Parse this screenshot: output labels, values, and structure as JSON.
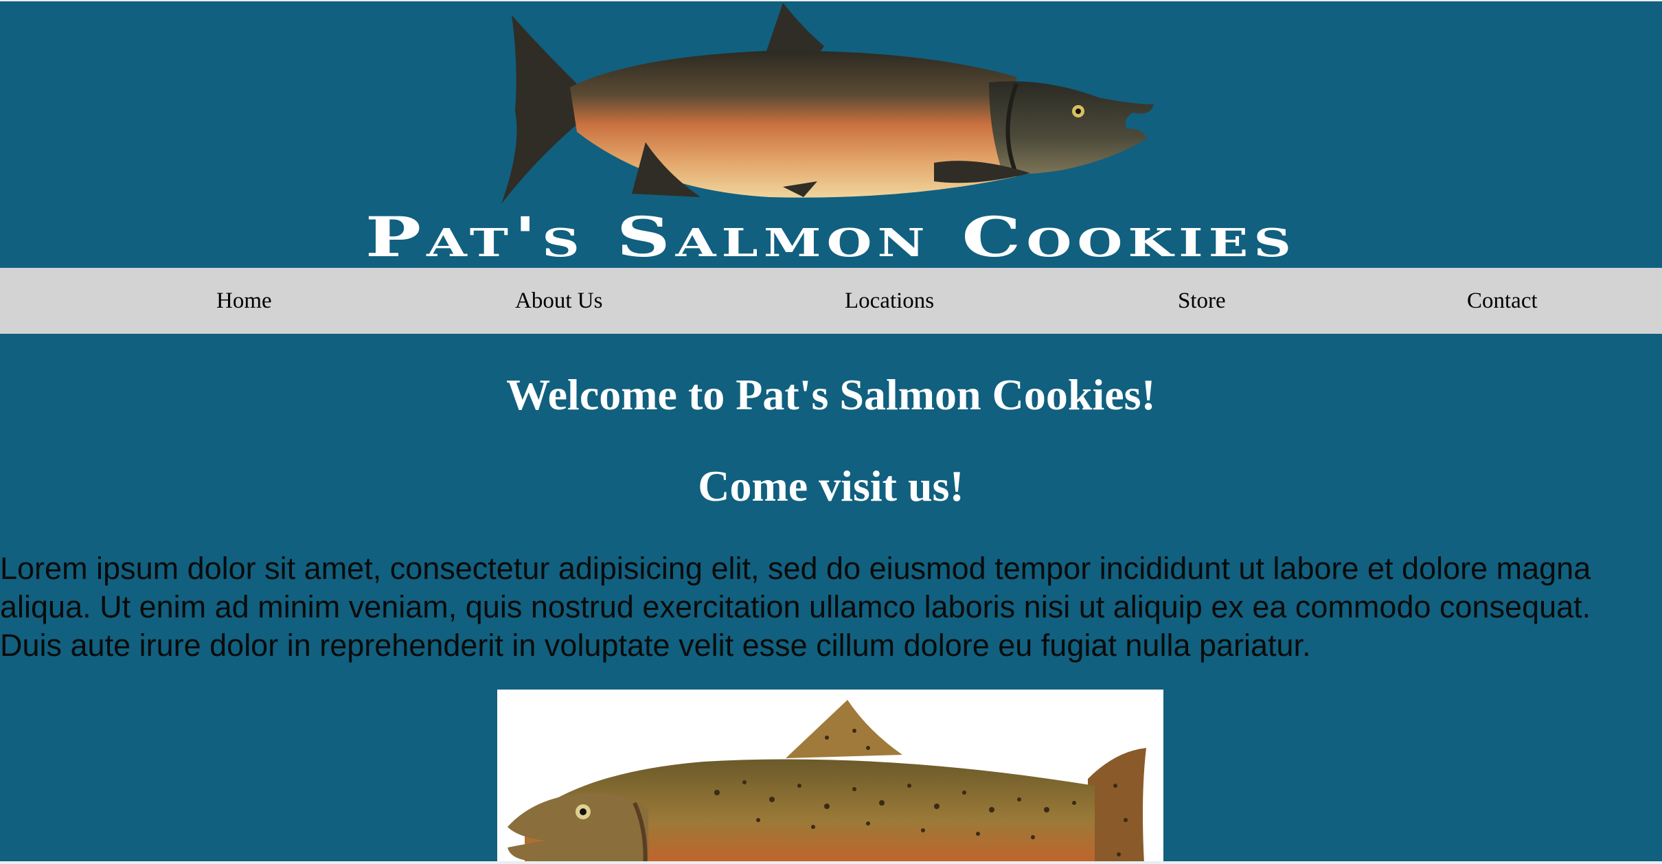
{
  "header": {
    "title": "Pat's Salmon Cookies",
    "logo_icon": "salmon-logo-icon"
  },
  "nav": {
    "items": [
      {
        "label": "Home"
      },
      {
        "label": "About Us"
      },
      {
        "label": "Locations"
      },
      {
        "label": "Store"
      },
      {
        "label": "Contact"
      }
    ]
  },
  "main": {
    "welcome_heading": "Welcome to Pat's Salmon Cookies!",
    "visit_heading": "Come visit us!",
    "paragraph": "Lorem ipsum dolor sit amet, consectetur adipisicing elit, sed do eiusmod tempor incididunt ut labore et dolore magna aliqua. Ut enim ad minim veniam, quis nostrud exercitation ullamco laboris nisi ut aliquip ex ea commodo consequat. Duis aute irure dolor in reprehenderit in voluptate velit esse cillum dolore eu fugiat nulla pariatur.",
    "photo_icon": "salmon-photo-icon"
  },
  "colors": {
    "page_background": "#11607f",
    "nav_background": "#d3d3d3",
    "heading_text": "#ffffff",
    "body_text": "#0b0b0b"
  }
}
